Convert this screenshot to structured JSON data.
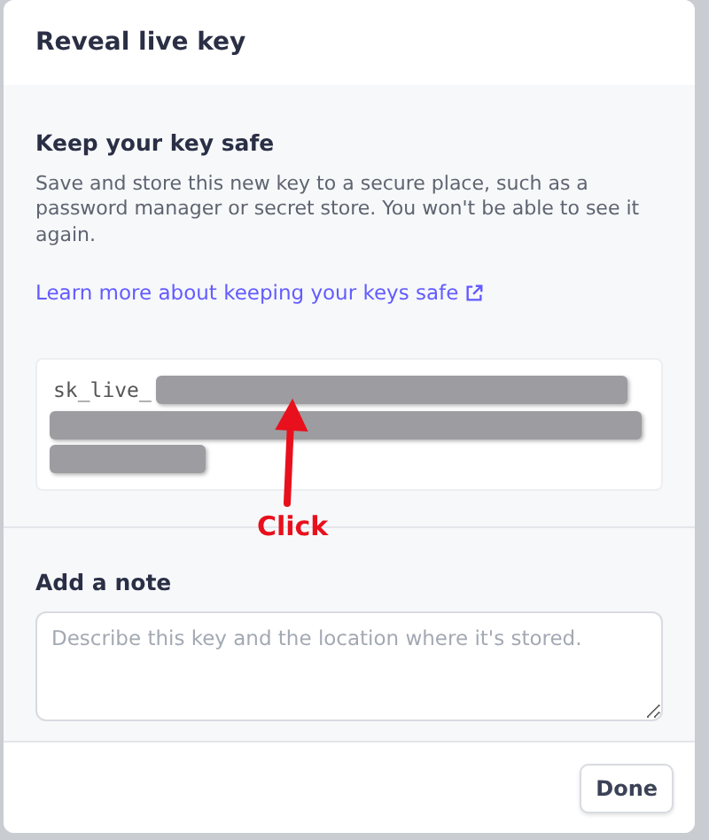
{
  "dialog": {
    "title": "Reveal live key"
  },
  "section": {
    "heading": "Keep your key safe",
    "description": "Save and store this new key to a secure place, such as a password manager or secret store. You won't be able to see it again.",
    "link": "Learn more about keeping your keys safe"
  },
  "key": {
    "prefix": "sk_live_",
    "redacted": true
  },
  "annotation": {
    "label": "Click"
  },
  "note": {
    "label": "Add a note",
    "placeholder": "Describe this key and the location where it's stored."
  },
  "buttons": [
    "Done"
  ]
}
